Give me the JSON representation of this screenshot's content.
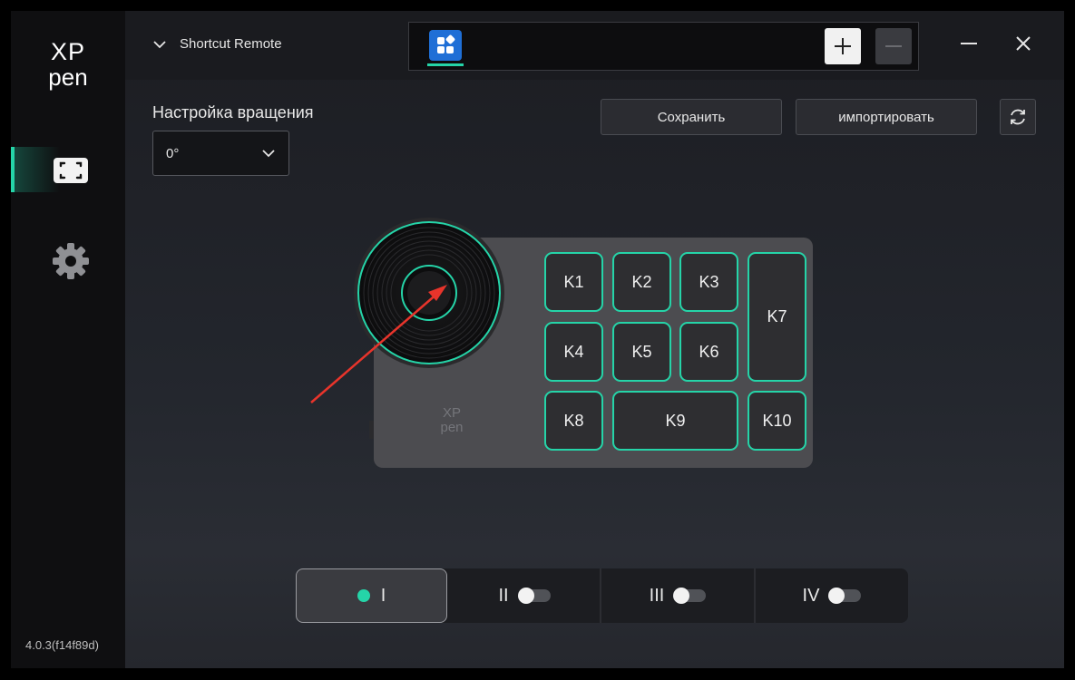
{
  "sidebar": {
    "logo_top": "XP",
    "logo_bottom": "pen",
    "nav": [
      {
        "icon": "screen-frame-icon",
        "active": true
      },
      {
        "icon": "gear-icon",
        "active": false
      }
    ],
    "version": "4.0.3(f14f89d)"
  },
  "header": {
    "device_name": "Shortcut Remote",
    "app_tab_icon": "apps-grid-icon",
    "add_icon": "plus-icon",
    "remove_icon": "minus-icon"
  },
  "rotation": {
    "label": "Настройка вращения",
    "value": "0°"
  },
  "toolbar": {
    "save_label": "Сохранить",
    "import_label": "импортировать",
    "refresh_icon": "refresh-icon"
  },
  "device": {
    "logo_top": "XP",
    "logo_bottom": "pen",
    "keys": [
      "K1",
      "K2",
      "K3",
      "K4",
      "K5",
      "K6",
      "K7",
      "K8",
      "K9",
      "K10"
    ]
  },
  "profiles": [
    {
      "label": "I",
      "active": true
    },
    {
      "label": "II",
      "active": false
    },
    {
      "label": "III",
      "active": false
    },
    {
      "label": "IV",
      "active": false
    }
  ],
  "colors": {
    "accent": "#25d4a8",
    "arrow": "#e8342b",
    "app_icon": "#1f6fd6"
  }
}
